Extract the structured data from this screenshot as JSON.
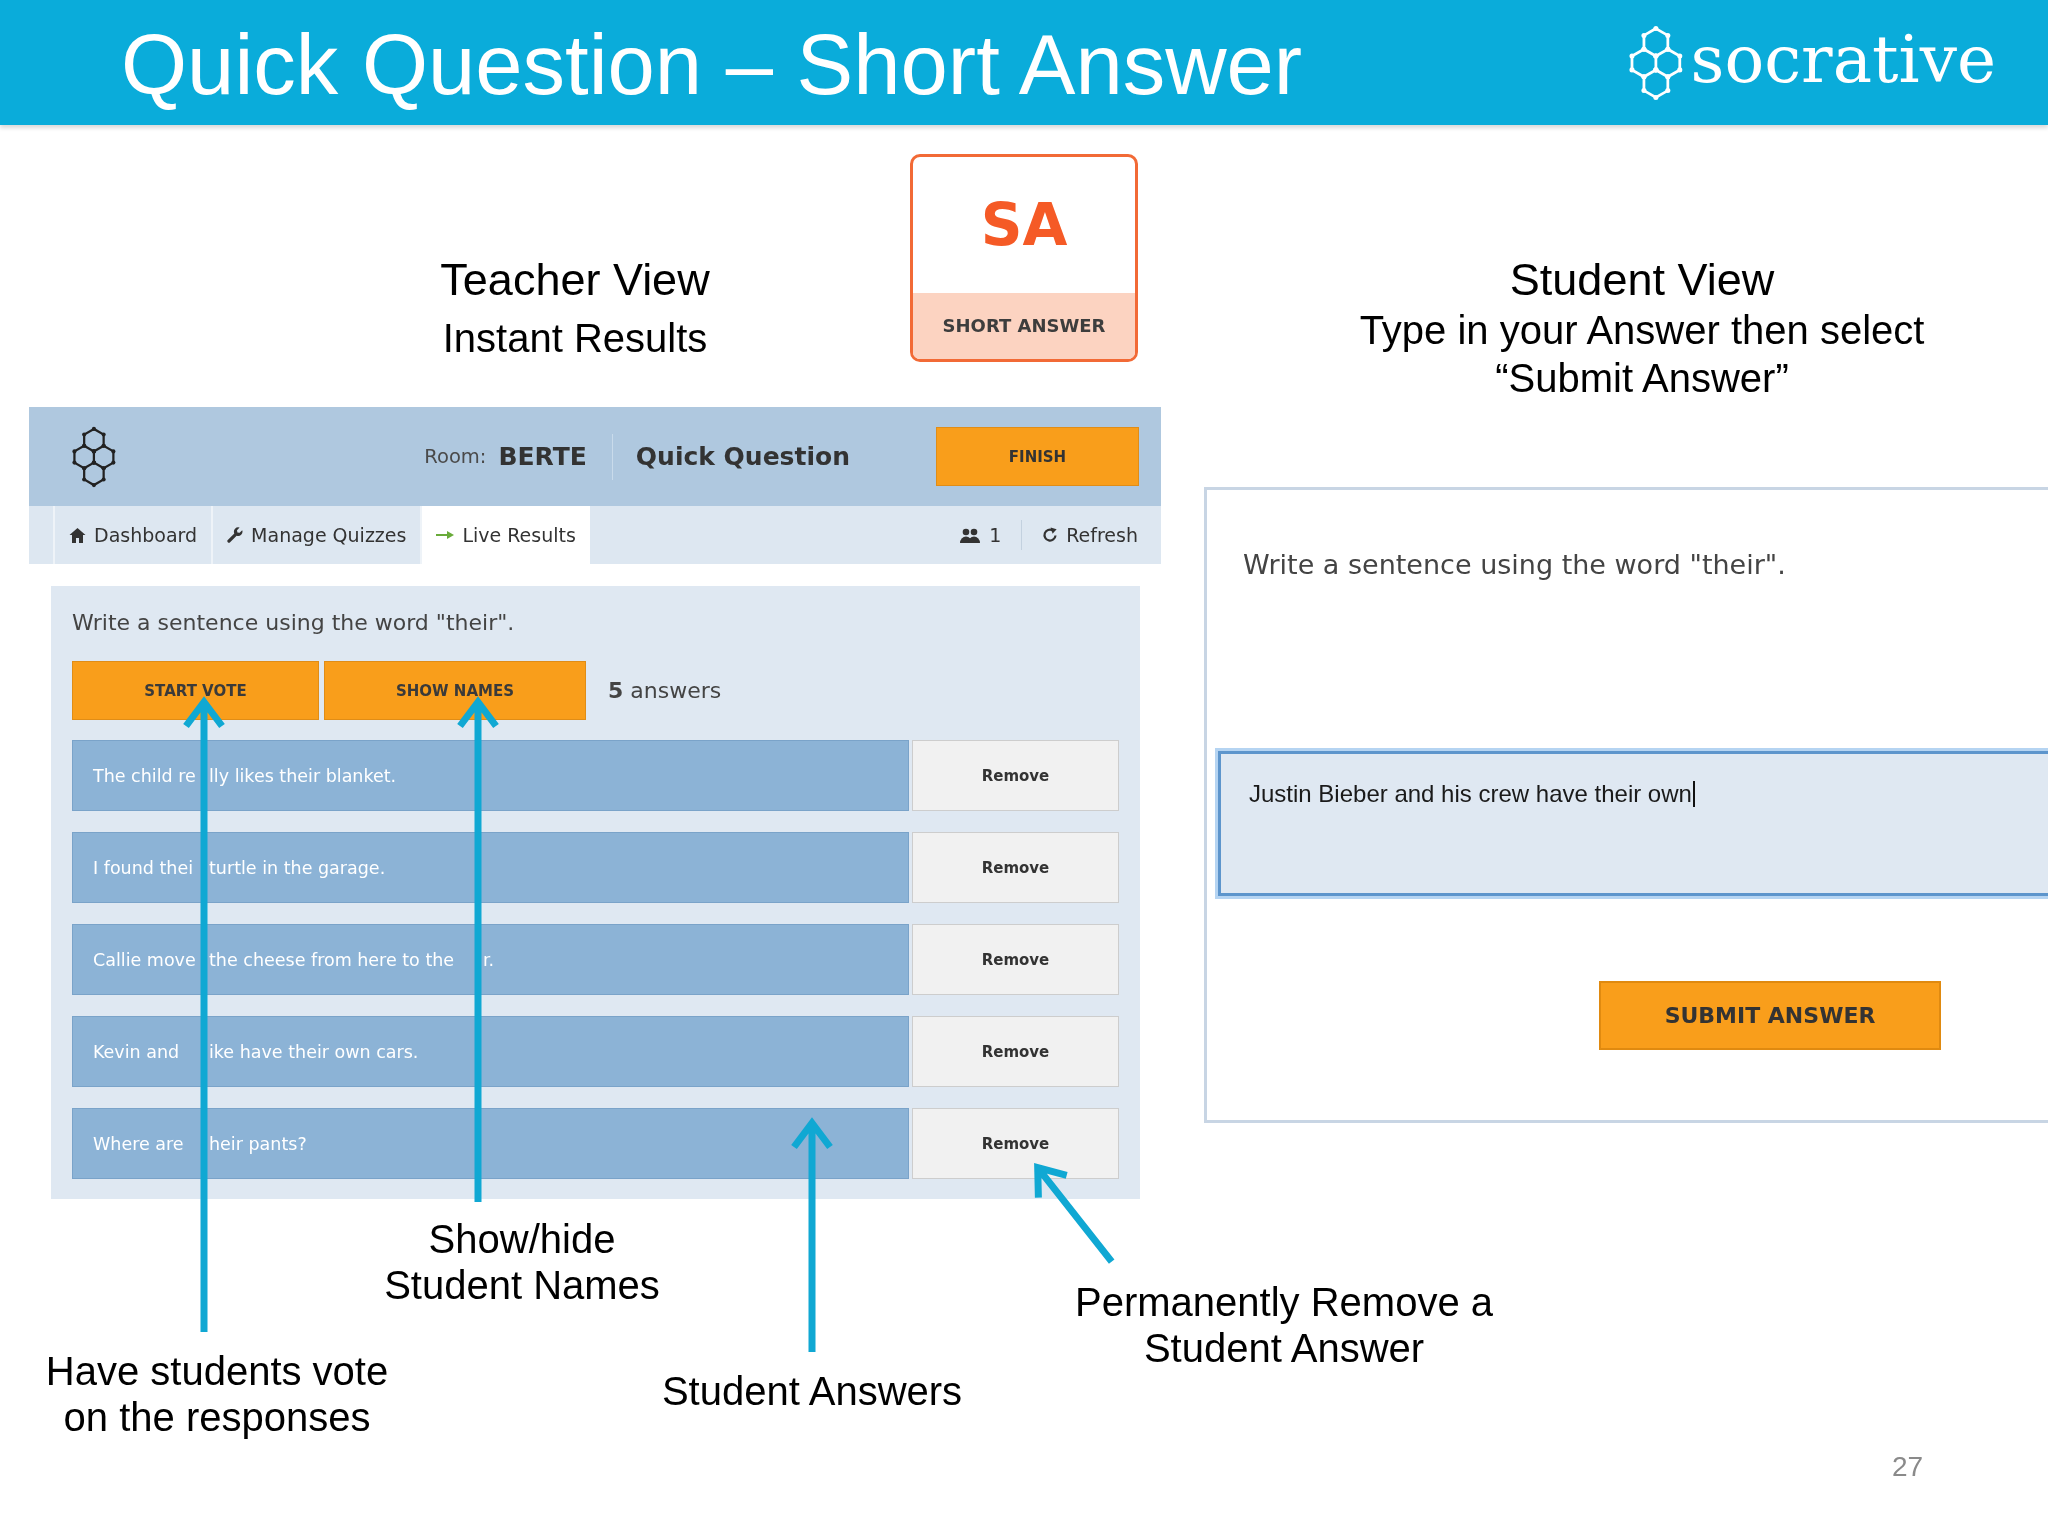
{
  "header": {
    "title": "Quick Question – Short Answer",
    "logo_text": "socrative"
  },
  "teacher_heading": {
    "title": "Teacher View",
    "subtitle_lines": [
      "Instant Results"
    ]
  },
  "question_type_card": {
    "abbreviation": "SA",
    "label": "SHORT ANSWER"
  },
  "student_heading": {
    "title": "Student View",
    "subtitle_lines": [
      "Type in your Answer then select",
      "“Submit Answer”"
    ]
  },
  "teacher_app": {
    "top_bar": {
      "room_label": "Room:",
      "room": "BERTE",
      "activity": "Quick Question",
      "finish_button": "FINISH"
    },
    "tabs": [
      {
        "label": "Dashboard",
        "selected": false
      },
      {
        "label": "Manage Quizzes",
        "selected": false
      },
      {
        "label": "Live Results",
        "selected": true
      }
    ],
    "student_count": "1",
    "refresh_button": "Refresh",
    "question": "Write a sentence using the word \"their\".",
    "buttons": [
      "START VOTE",
      "SHOW NAMES"
    ],
    "answer_count": "**5** answers",
    "answers": [
      {
        "visible_parts": [
          "The child re",
          "lly likes their blanket."
        ],
        "remove_button": "Remove"
      },
      {
        "visible_parts": [
          "I found thei",
          "turtle in the garage."
        ],
        "remove_button": "Remove"
      },
      {
        "visible_parts": [
          "Callie move",
          "the cheese from here to the",
          "r."
        ],
        "remove_button": "Remove"
      },
      {
        "visible_parts": [
          "Kevin and",
          "ike have their own cars."
        ],
        "remove_button": "Remove"
      },
      {
        "visible_parts": [
          "Where are",
          "heir pants?"
        ],
        "remove_button": "Remove"
      }
    ]
  },
  "student_app": {
    "question": "Write a sentence using the word \"their\".",
    "answer_field": {
      "value": "Justin Bieber and his crew have their own"
    },
    "submit_button": "SUBMIT ANSWER"
  },
  "callouts": [
    {
      "lines": [
        "Have students vote",
        "on the responses"
      ]
    },
    {
      "lines": [
        "Show/hide",
        "Student Names"
      ]
    },
    {
      "lines": [
        "Student Answers"
      ]
    },
    {
      "lines": [
        "Permanently Remove a",
        "Student Answer"
      ]
    }
  ],
  "page_number": "27"
}
